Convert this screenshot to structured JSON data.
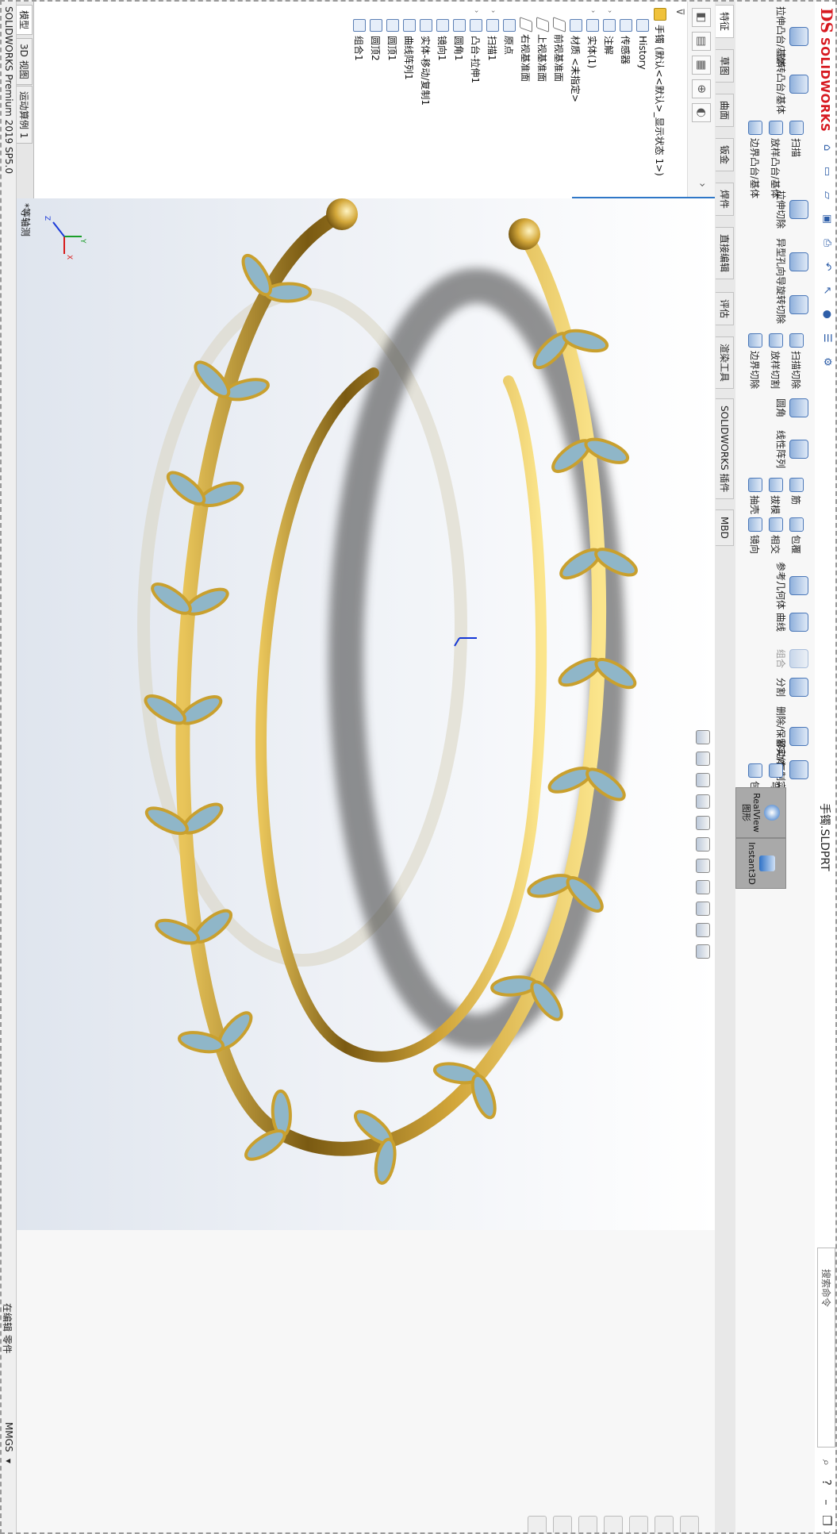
{
  "window": {
    "brand_mark": "DS",
    "brand_name": "SOLIDWORKS",
    "document_title": "手镯.SLDPRT",
    "search_placeholder": "搜索命令",
    "minimize": "–",
    "restore": "❐",
    "close": "✕",
    "help": "?"
  },
  "commands": {
    "extrude_boss": "拉伸凸台/基体",
    "revolve_boss": "旋转凸台/基体",
    "sweep": "扫描",
    "loft": "放样凸台/基体",
    "boundary_boss": "边界凸台/基体",
    "extrude_cut": "拉伸切除",
    "hole_wizard": "异型孔向导",
    "revolve_cut": "旋转切除",
    "swept_cut": "扫描切除",
    "lofted_cut": "放样切割",
    "boundary_cut": "边界切除",
    "fillet": "圆角",
    "linear_pattern": "线性阵列",
    "rib": "筋",
    "draft": "拔模",
    "shell": "抽壳",
    "wrap": "包覆",
    "intersect": "相交",
    "mirror": "镜向",
    "ref_geometry": "参考几何体",
    "curves": "曲线",
    "combine": "组合",
    "split": "分割",
    "delete_keep_body": "删除/保留实体",
    "move_copy_body": "移动/复制实体",
    "flex": "弯曲",
    "wrap2": "包覆",
    "realview": "RealView 图形",
    "instant3d": "Instant3D"
  },
  "tabs": [
    "特征",
    "草图",
    "曲面",
    "钣金",
    "焊件",
    "直接编辑",
    "评估",
    "渲染工具",
    "SOLIDWORKS 插件",
    "MBD"
  ],
  "feature_tree": {
    "root": "手镯 (默认<<默认>_显示状态 1>)",
    "items": [
      {
        "label": "History",
        "expand": ""
      },
      {
        "label": "传感器",
        "expand": ""
      },
      {
        "label": "注解",
        "expand": "›"
      },
      {
        "label": "实体(1)",
        "expand": "›"
      },
      {
        "label": "材质 <未指定>",
        "expand": ""
      },
      {
        "label": "前视基准面",
        "expand": ""
      },
      {
        "label": "上视基准面",
        "expand": ""
      },
      {
        "label": "右视基准面",
        "expand": ""
      },
      {
        "label": "原点",
        "expand": ""
      },
      {
        "label": "扫描1",
        "expand": "›"
      },
      {
        "label": "凸台-拉伸1",
        "expand": "›"
      },
      {
        "label": "圆角1",
        "expand": ""
      },
      {
        "label": "镜向1",
        "expand": ""
      },
      {
        "label": "实体-移动/复制1",
        "expand": ""
      },
      {
        "label": "曲线阵列1",
        "expand": ""
      },
      {
        "label": "圆顶1",
        "expand": ""
      },
      {
        "label": "圆顶2",
        "expand": ""
      },
      {
        "label": "组合1",
        "expand": ""
      }
    ]
  },
  "graphics": {
    "view_label": "*等轴测",
    "axis_x": "X",
    "axis_y": "Y",
    "axis_z": "Z"
  },
  "model_tabs": [
    "模型",
    "3D 视图",
    "运动算例 1"
  ],
  "status": {
    "left": "SOLIDWORKS Premium 2019 SP5.0",
    "editing": "在编辑 零件",
    "units": "MMGS",
    "units_arrow": "▾"
  },
  "colors": {
    "brand_red": "#d71920",
    "gold": "#c9a02e",
    "leaf_blue": "#8fb6c8",
    "accent_blue": "#2d71c7"
  }
}
